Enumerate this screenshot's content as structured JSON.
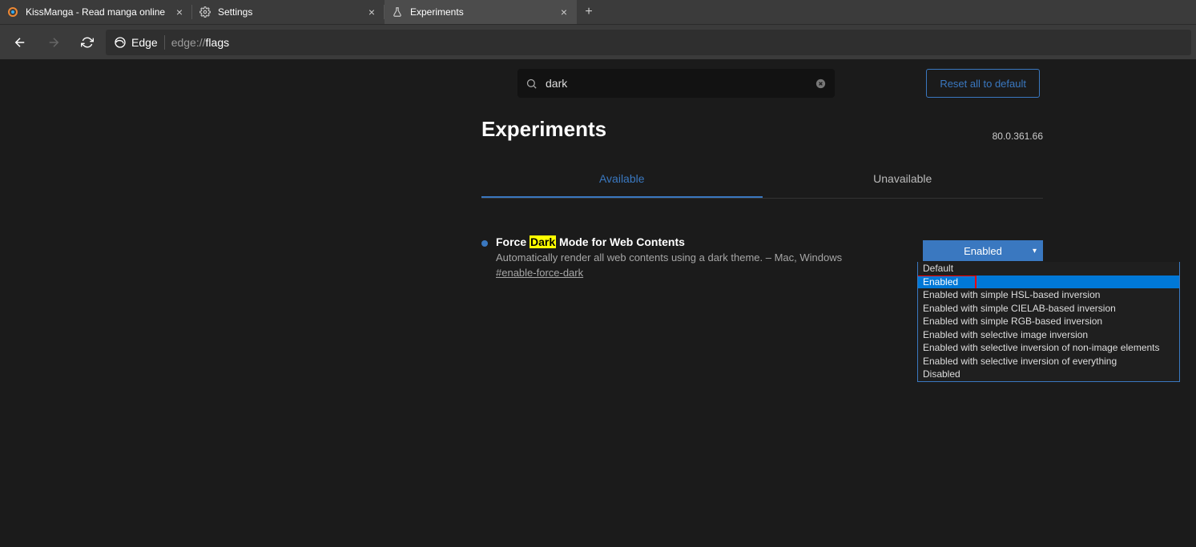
{
  "tabs": [
    {
      "label": "KissManga - Read manga online"
    },
    {
      "label": "Settings"
    },
    {
      "label": "Experiments"
    }
  ],
  "address": {
    "brand": "Edge",
    "url_dim": "edge://",
    "url_main": "flags"
  },
  "search": {
    "value": "dark"
  },
  "reset_label": "Reset all to default",
  "page_title": "Experiments",
  "version": "80.0.361.66",
  "tab_available": "Available",
  "tab_unavailable": "Unavailable",
  "flag": {
    "title_pre": "Force ",
    "title_hl": "Dark",
    "title_post": " Mode for Web Contents",
    "description": "Automatically render all web contents using a dark theme. – Mac, Windows",
    "tag": "#enable-force-dark",
    "selected": "Enabled"
  },
  "dropdown_options": [
    "Default",
    "Enabled",
    "Enabled with simple HSL-based inversion",
    "Enabled with simple CIELAB-based inversion",
    "Enabled with simple RGB-based inversion",
    "Enabled with selective image inversion",
    "Enabled with selective inversion of non-image elements",
    "Enabled with selective inversion of everything",
    "Disabled"
  ]
}
